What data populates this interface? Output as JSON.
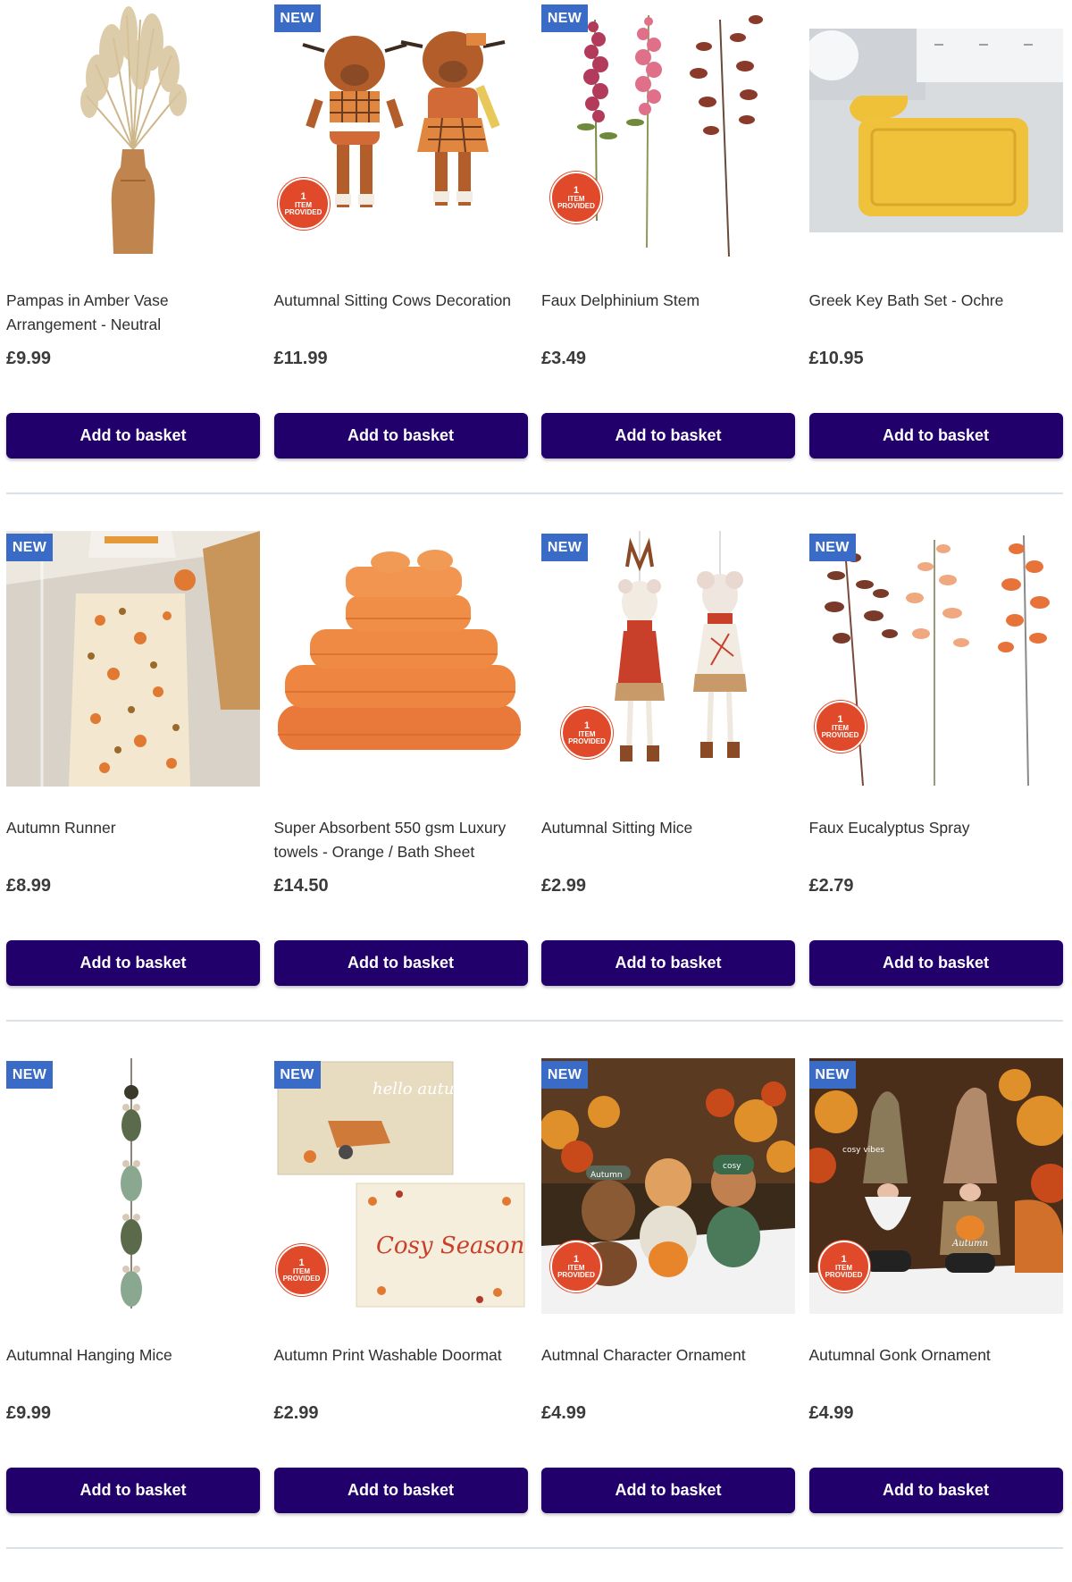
{
  "badges": {
    "new": "NEW",
    "provided_num": "1",
    "provided_line1": "ITEM",
    "provided_line2": "PROVIDED"
  },
  "button_label": "Add to basket",
  "colors": {
    "button": "#22006b",
    "new_badge": "#3a6bc7",
    "provided_badge": "#e04a2a"
  },
  "products": [
    {
      "title": "Pampas in Amber Vase Arrangement - Neutral",
      "price": "£9.99",
      "image": "pampas-vase"
    },
    {
      "title": "Autumnal Sitting Cows Decoration",
      "price": "£11.99",
      "image": "sitting-cows"
    },
    {
      "title": "Faux Delphinium Stem",
      "price": "£3.49",
      "image": "delphinium-stems"
    },
    {
      "title": "Greek Key Bath Set - Ochre",
      "price": "£10.95",
      "image": "bath-mat-set"
    },
    {
      "title": "Autumn Runner",
      "price": "£8.99",
      "image": "autumn-runner-rug"
    },
    {
      "title": "Super Absorbent 550 gsm Luxury towels - Orange / Bath Sheet",
      "price": "£14.50",
      "image": "orange-towels"
    },
    {
      "title": "Autumnal Sitting Mice",
      "price": "£2.99",
      "image": "sitting-mice"
    },
    {
      "title": "Faux Eucalyptus Spray",
      "price": "£2.79",
      "image": "eucalyptus-spray"
    },
    {
      "title": "Autumnal Hanging Mice",
      "price": "£9.99",
      "image": "hanging-mice"
    },
    {
      "title": "Autumn Print Washable Doormat",
      "price": "£2.99",
      "image": "doormats",
      "image_text_1": "hello autumn",
      "image_text_2": "Cosy Season"
    },
    {
      "title": "Autmnal Character Ornament",
      "price": "£4.99",
      "image": "character-ornaments",
      "image_text_1": "Autumn",
      "image_text_2": "cosy"
    },
    {
      "title": "Autumnal Gonk Ornament",
      "price": "£4.99",
      "image": "gonk-ornaments",
      "image_text_1": "cosy vibes",
      "image_text_2": "Autumn"
    }
  ]
}
